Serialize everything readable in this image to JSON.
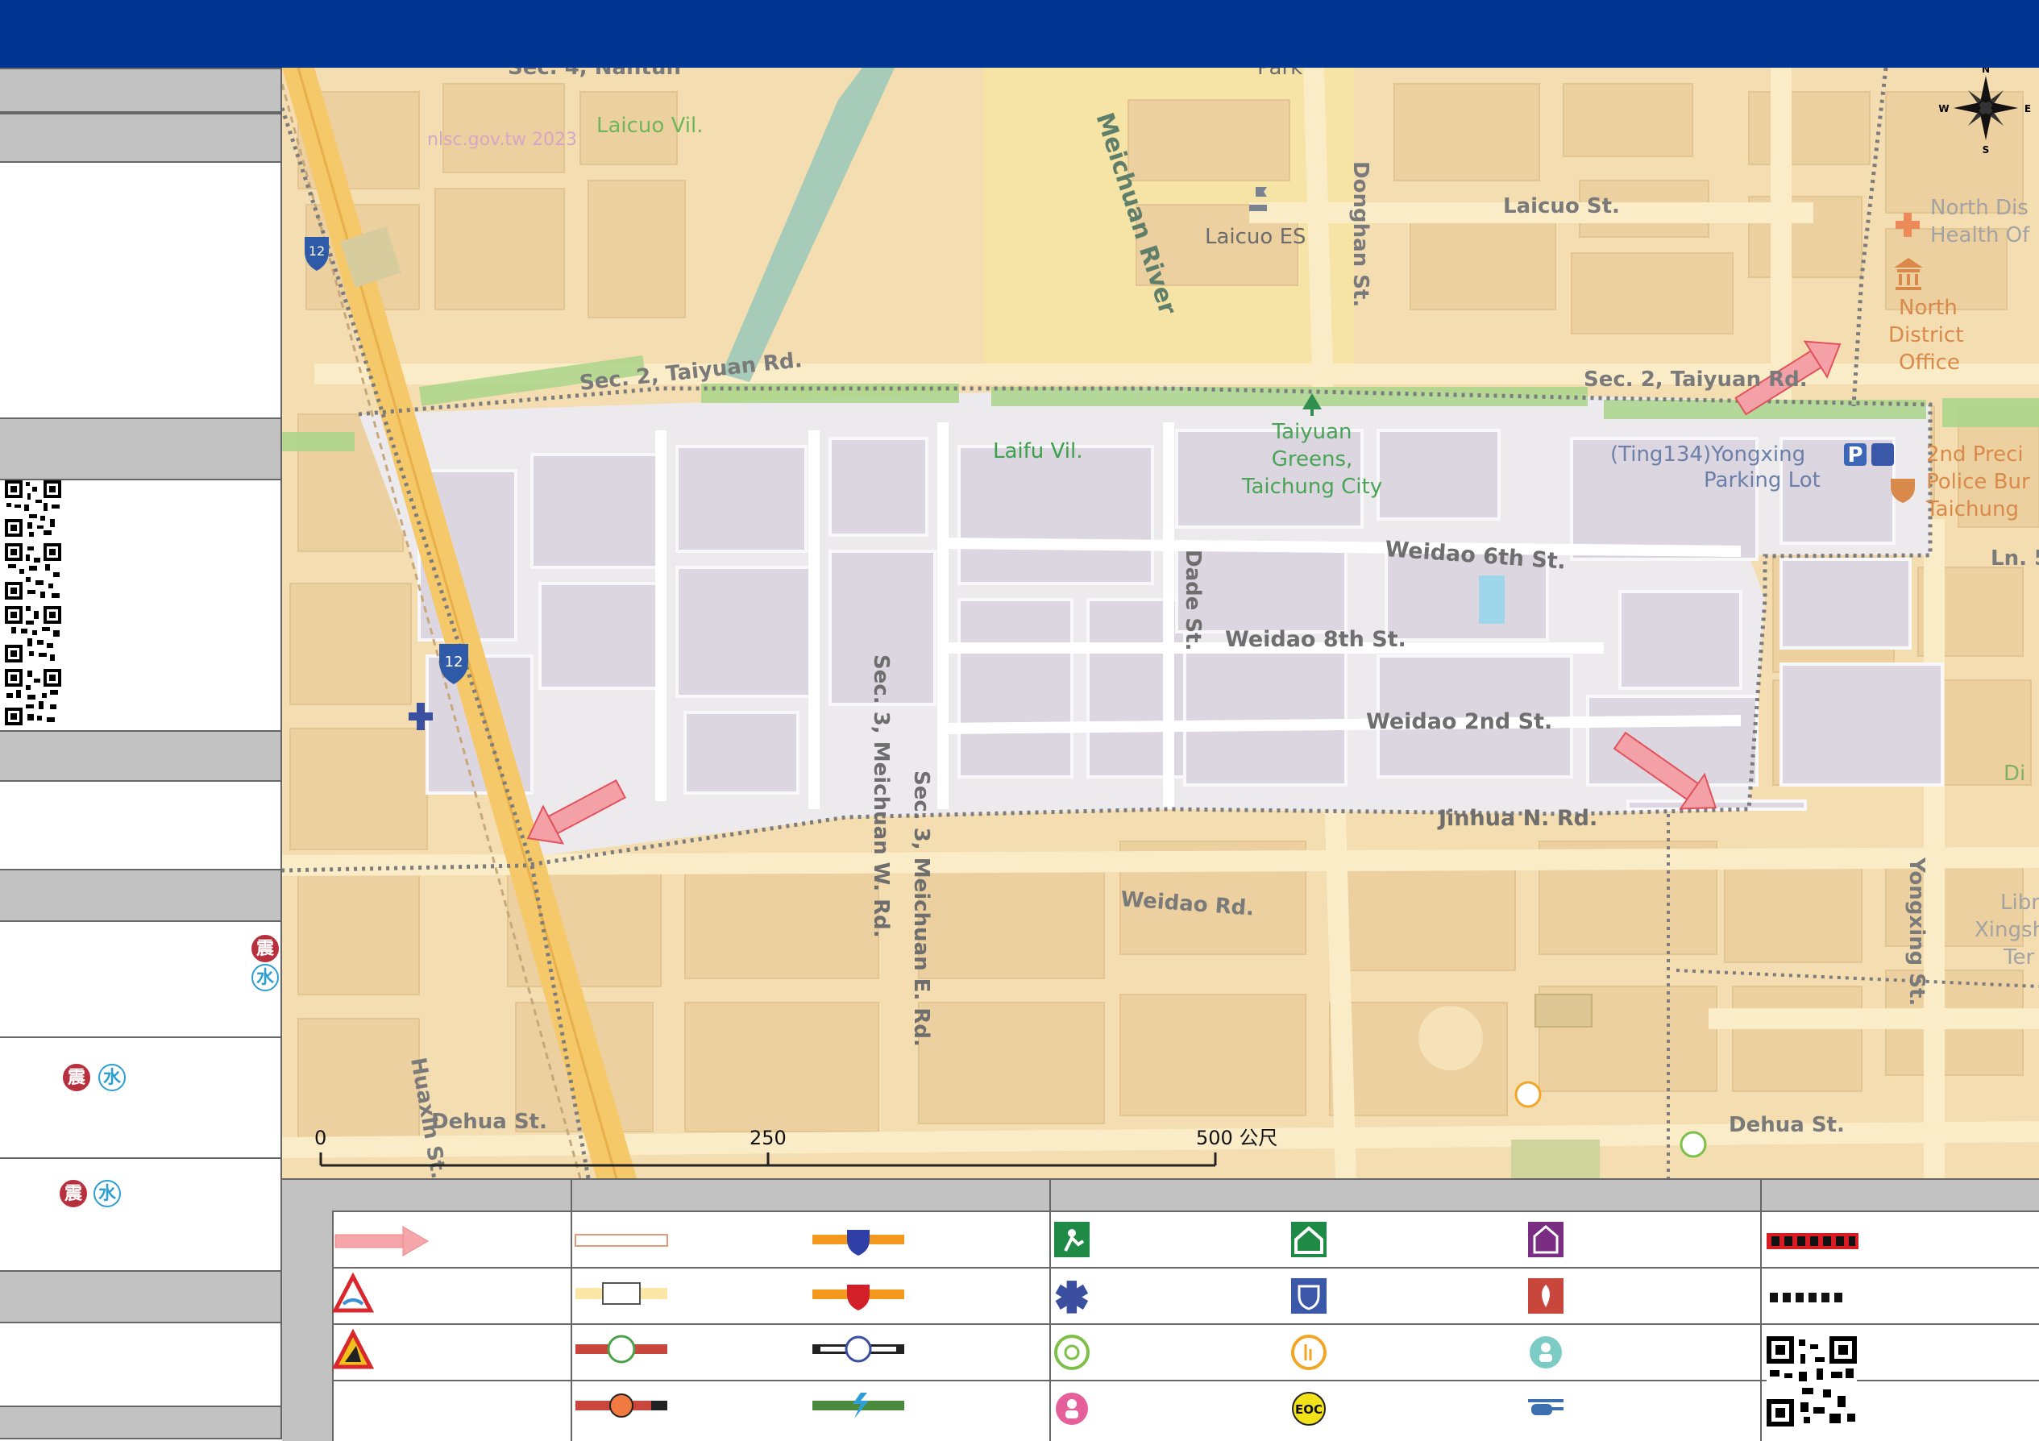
{
  "colors": {
    "header": "#003591",
    "panel_grey": "#c2c2c2",
    "map_base": "#f3ddb1",
    "block": "#ecd0a0",
    "evac_zone": "#eceaed",
    "green": "#a9d58a",
    "river": "#a6cbb8",
    "evac_arrow": "#f04a55",
    "highway": "#f5c86a"
  },
  "hazard_badges": {
    "quake": "震",
    "water": "水"
  },
  "map": {
    "watermark": "nlsc.gov.tw 2023",
    "villages": [
      "Laicuo Vil.",
      "Laifu Vil."
    ],
    "roads": {
      "taiyuan_left": "Sec. 2, Taiyuan Rd.",
      "taiyuan_right": "Sec. 2, Taiyuan Rd.",
      "laicuo": "Laicuo St.",
      "donghan": "Donghan St.",
      "weidao6": "Weidao 6th St.",
      "weidao8": "Weidao 8th St.",
      "weidao2": "Weidao 2nd St.",
      "jinhua": "Jinhua N. Rd.",
      "weidao_rd": "Weidao Rd.",
      "dade": "Dade St.",
      "meichuan_w": "Sec. 3, Meichuan W. Rd.",
      "meichuan_e": "Sec. 3, Meichuan E. Rd.",
      "dehua_left": "Dehua St.",
      "dehua_right": "Dehua St.",
      "huaxin": "Huaxin St.",
      "yongxing": "Yongxing St.",
      "top_cut": "Sec. 4, Nantun",
      "ln5": "Ln. 5"
    },
    "river": "Meichuan River",
    "pois": {
      "school": "Laicuo ES",
      "park_top": "Park",
      "greens": [
        "Taiyuan",
        "Greens,",
        "Taichung City"
      ],
      "parking": [
        "(Ting134)Yongxing",
        "Parking Lot"
      ],
      "health": [
        "North Dis",
        "Health Of"
      ],
      "district": [
        "North",
        "District",
        "Office"
      ],
      "police": [
        "2nd Preci",
        "Police Bur",
        "Taichung"
      ],
      "library": [
        "Libr",
        "Xingsh",
        "Ter"
      ],
      "di": "Di"
    },
    "compass": {
      "n": "N",
      "s": "S",
      "e": "E",
      "w": "W"
    },
    "scale": {
      "ticks": [
        "0",
        "250",
        "500 公尺"
      ],
      "max_m": 500
    }
  }
}
